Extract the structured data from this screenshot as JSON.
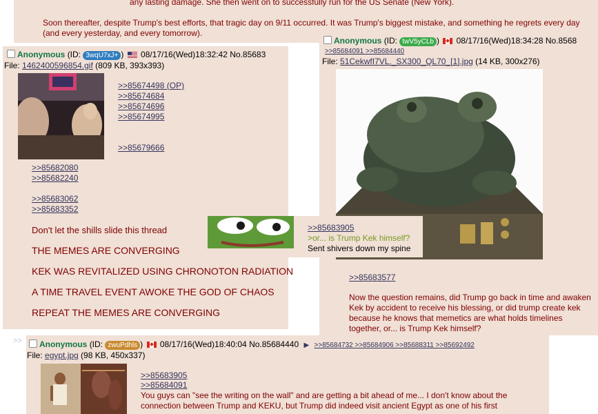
{
  "top_post": {
    "line1": "any lasting damage. She then went on to successfully run for the US Senate (New York).",
    "line2": "Soon thereafter, despite Trump's best efforts, that tragic day on 9/11 occurred. It was Trump's biggest mistake, and something he regrets every day (and every yesterday, and every tomorrow)."
  },
  "post_left": {
    "name": "Anonymous",
    "id_prefix": "(ID: ",
    "id": "3wqU7xJ+",
    "id_suffix": ")",
    "meta": "08/17/16(Wed)18:32:42 No.85683",
    "file_label": "File: ",
    "file_name": "1462400596854.gif",
    "file_info": " (809 KB, 393x393)",
    "side_links": [
      ">>85674498 (OP)",
      ">>85674684",
      ">>85674696",
      ">>85674995",
      ">>85679666"
    ],
    "links": [
      ">>85682080",
      ">>85682240",
      ">>85683062",
      ">>85683352"
    ],
    "lines": [
      "Don't let the shills slide this thread",
      "THE MEMES ARE CONVERGING",
      "KEK WAS REVITALIZED USING CHRONOTON RADIATION",
      "A TIME TRAVEL EVENT AWOKE THE GOD OF CHAOS",
      "REPEAT THE MEMES ARE CONVERGING"
    ],
    "id_color": "#2e7dbf"
  },
  "post_right": {
    "name": "Anonymous",
    "id_prefix": "(ID: ",
    "id": "twV5yCLb",
    "id_suffix": ")",
    "meta": "08/17/16(Wed)18:34:28 No.8568",
    "backlinks": ">>85684091 >>85684440",
    "file_label": "File: ",
    "file_name": "51CekwfI7VL._SX300_QL70_[1].jpg",
    "file_info": " (14 KB, 300x276)",
    "link": ">>85683577",
    "text": "Now the question remains, did Trump go back in time and awaken Kek by accident to receive his blessing, or did trump create kek because he knows that memetics are what holds timelines together, or... is Trump Kek himself?",
    "id_color": "#3cab4b"
  },
  "popup": {
    "link": ">>85683905",
    "greentext": ">or... is Trump Kek himself?",
    "text": "Sent shivers down my spine"
  },
  "post_bottom": {
    "arrow": ">>",
    "name": "Anonymous",
    "id_prefix": "(ID: ",
    "id": "zwuPdhls",
    "id_suffix": ")",
    "meta": "08/17/16(Wed)18:40:04 No.85684440",
    "play": "▶",
    "backlinks": ">>85684732 >>85684906 >>85688311 >>85692492",
    "file_label": "File: ",
    "file_name": "egypt.jpg",
    "file_info": " (98 KB, 450x337)",
    "links": [
      ">>85683905",
      ">>85684091"
    ],
    "text": "You guys can \"see the writing on the wall\" and are getting a bit ahead of me... I don't know about the connection between Trump and KEKU, but Trump did indeed visit ancient Egypt as one of his first",
    "id_color": "#c98a2f"
  },
  "colors": {
    "post_bg": "#f0e0d6",
    "text": "#800000",
    "name": "#117743",
    "link": "#34345c",
    "greentext": "#789922"
  }
}
